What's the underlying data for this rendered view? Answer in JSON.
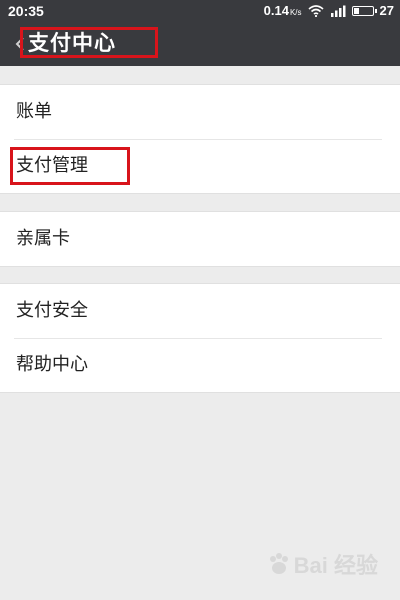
{
  "status_bar": {
    "time": "20:35",
    "net_speed": "0.14",
    "net_unit": "K/s",
    "battery": "27",
    "battery_level": 0.27
  },
  "nav": {
    "title": "支付中心",
    "back_icon": "chevron-left-icon"
  },
  "groups": [
    {
      "items": [
        {
          "label": "账单"
        },
        {
          "label": "支付管理"
        }
      ]
    },
    {
      "items": [
        {
          "label": "亲属卡"
        }
      ]
    },
    {
      "items": [
        {
          "label": "支付安全"
        },
        {
          "label": "帮助中心"
        }
      ]
    }
  ],
  "annotation_color": "#d8141b",
  "header_color": "#393a3e",
  "watermark": {
    "text": "Bai 经验"
  }
}
